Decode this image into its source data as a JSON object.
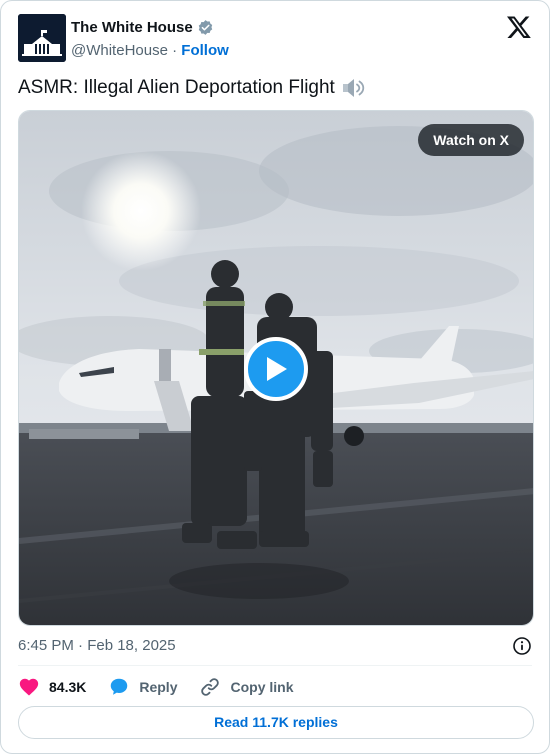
{
  "author": {
    "display_name": "The White House",
    "handle": "@WhiteHouse",
    "separator": "·",
    "follow_label": "Follow",
    "verified": true
  },
  "tweet": {
    "text": "ASMR: Illegal Alien Deportation Flight",
    "timestamp": "6:45 PM · Feb 18, 2025"
  },
  "media": {
    "type": "video",
    "watch_label": "Watch on X"
  },
  "actions": {
    "likes": "84.3K",
    "reply_label": "Reply",
    "copy_link_label": "Copy link"
  },
  "read_replies_label": "Read 11.7K replies",
  "icons": {
    "logo": "x-logo-icon",
    "verified": "verified-badge-icon",
    "speaker": "speaker-icon",
    "play": "play-icon",
    "info": "info-icon",
    "like": "heart-icon",
    "reply": "speech-bubble-icon",
    "copy": "link-icon"
  },
  "colors": {
    "accent": "#1d9bf0",
    "link": "#006fd6",
    "like": "#f91880",
    "secondary_text": "#536471"
  }
}
